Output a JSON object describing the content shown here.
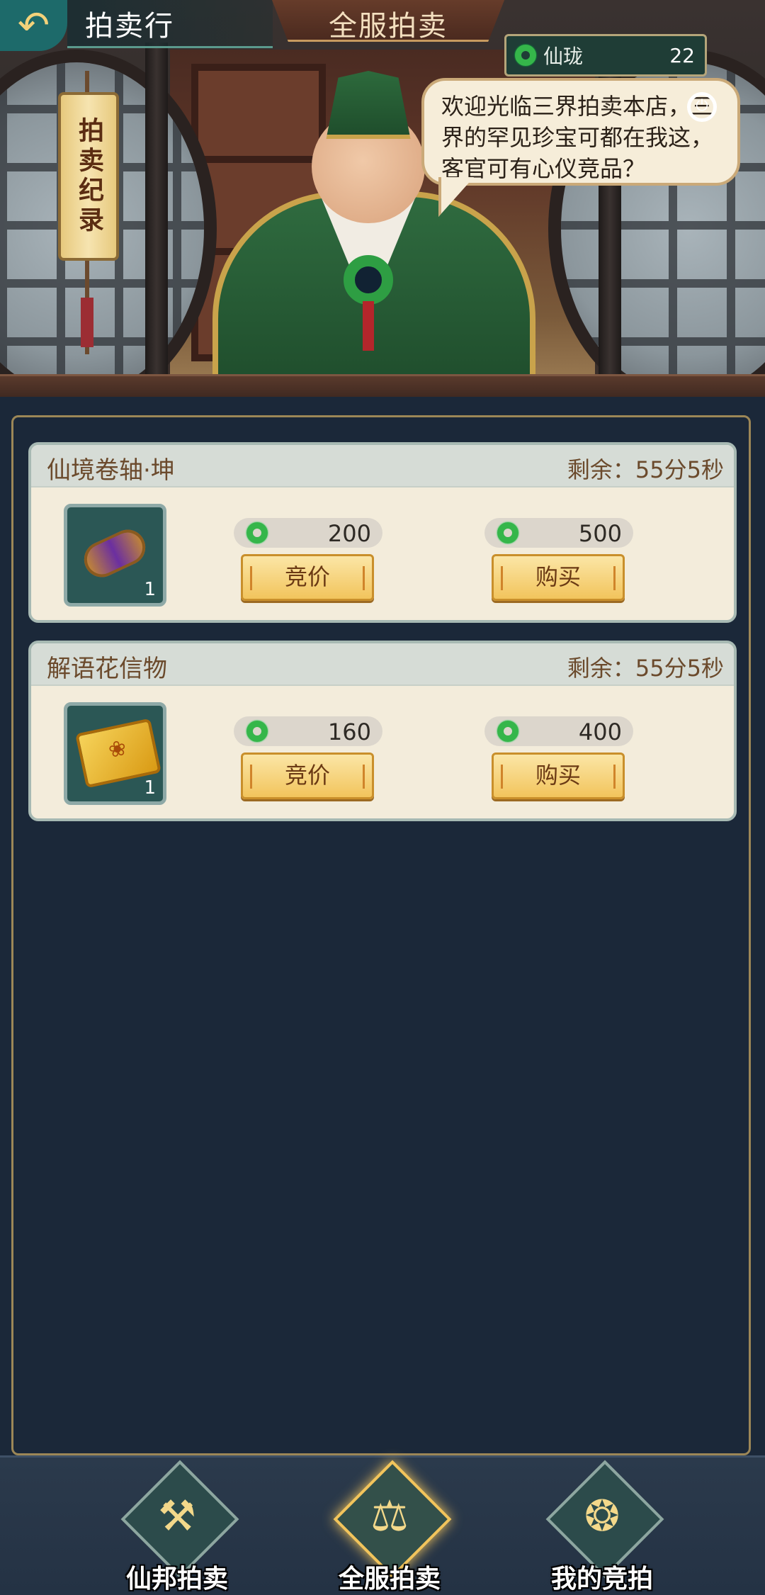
{
  "header": {
    "title": "拍卖行",
    "active_tab": "全服拍卖"
  },
  "currency": {
    "name": "仙珑",
    "amount": "22",
    "icon": "jade-ring-icon",
    "color": "#35b64a"
  },
  "record_button": {
    "label": "拍卖纪录"
  },
  "npc": {
    "speech": "欢迎光临三界拍卖本店，三界的罕见珍宝可都在我这，客官可有心仪竞品？"
  },
  "auctions": [
    {
      "name": "仙境卷轴·坤",
      "time_left": "剩余：55分5秒",
      "quantity": "1",
      "icon": "scroll-item-icon",
      "bid_price": "200",
      "buy_price": "500",
      "bid_label": "竞价",
      "buy_label": "购买"
    },
    {
      "name": "解语花信物",
      "time_left": "剩余：55分5秒",
      "quantity": "1",
      "icon": "token-item-icon",
      "bid_price": "160",
      "buy_price": "400",
      "bid_label": "竞价",
      "buy_label": "购买"
    }
  ],
  "bottom_nav": [
    {
      "label": "仙邦拍卖",
      "icon": "gavel-icon",
      "active": false
    },
    {
      "label": "全服拍卖",
      "icon": "scales-icon",
      "active": true
    },
    {
      "label": "我的竞拍",
      "icon": "money-bag-icon",
      "active": false
    }
  ]
}
